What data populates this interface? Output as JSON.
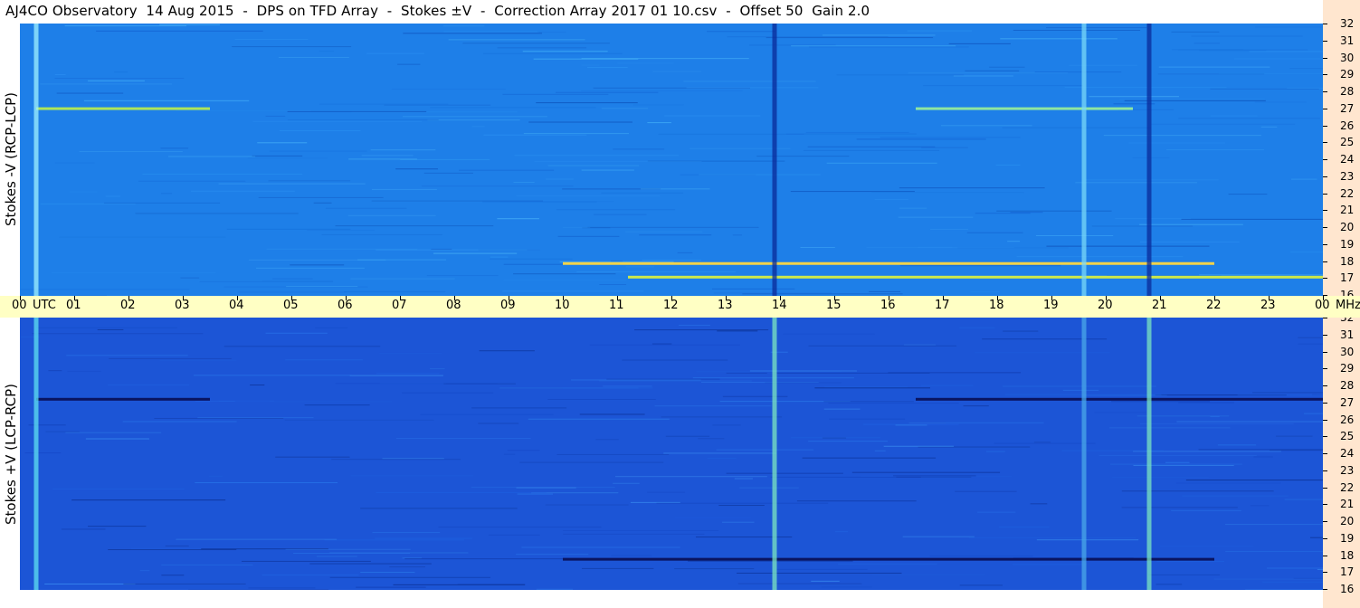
{
  "title": "AJ4CO Observatory  14 Aug 2015  -  DPS on TFD Array  -  Stokes ±V  -  Correction Array 2017 01 10.csv  -  Offset 50  Gain 2.0",
  "top_panel": {
    "ylabel": "Stokes -V (RCP-LCP)"
  },
  "bottom_panel": {
    "ylabel": "Stokes +V (LCP-RCP)"
  },
  "time_axis": {
    "labels": [
      "00",
      "UTC",
      "01",
      "02",
      "03",
      "04",
      "05",
      "06",
      "07",
      "08",
      "09",
      "10",
      "11",
      "12",
      "13",
      "14",
      "15",
      "16",
      "17",
      "18",
      "19",
      "20",
      "21",
      "22",
      "23",
      "00",
      "MHz"
    ]
  },
  "freq_axis": {
    "labels": [
      "32",
      "31",
      "30",
      "29",
      "28",
      "27",
      "26",
      "25",
      "24",
      "23",
      "22",
      "21",
      "20",
      "19",
      "18",
      "17",
      "16"
    ]
  },
  "colors": {
    "top_background": "#1e7fe8",
    "bottom_background": "#1c55d6",
    "time_bar": "#ffffc4",
    "freq_column": "#ffe6cf"
  },
  "chart_data": [
    {
      "type": "heatmap",
      "title": "Stokes -V (RCP-LCP)",
      "x_unit": "UTC hour",
      "y_unit": "MHz",
      "xlim": [
        0,
        24
      ],
      "ylim": [
        16,
        32
      ],
      "features": [
        {
          "kind": "band",
          "freq_mhz": 17.9,
          "t_start": 10.0,
          "t_end": 22.0,
          "color": "#f2d34a"
        },
        {
          "kind": "band",
          "freq_mhz": 17.1,
          "t_start": 11.2,
          "t_end": 24.0,
          "color": "#cce84a"
        },
        {
          "kind": "band",
          "freq_mhz": 27.0,
          "t_start": 0.3,
          "t_end": 3.5,
          "color": "#aee65a"
        },
        {
          "kind": "band",
          "freq_mhz": 27.0,
          "t_start": 16.5,
          "t_end": 20.5,
          "color": "#8fe6a0"
        },
        {
          "kind": "column",
          "t_hour": 0.3,
          "color": "#9ff0ff"
        },
        {
          "kind": "column",
          "t_hour": 13.9,
          "color": "#0a2a9a"
        },
        {
          "kind": "column",
          "t_hour": 19.6,
          "color": "#7ad8f8"
        },
        {
          "kind": "column",
          "t_hour": 20.8,
          "color": "#0a2a9a"
        }
      ]
    },
    {
      "type": "heatmap",
      "title": "Stokes +V (LCP-RCP)",
      "x_unit": "UTC hour",
      "y_unit": "MHz",
      "xlim": [
        0,
        24
      ],
      "ylim": [
        16,
        32
      ],
      "features": [
        {
          "kind": "band",
          "freq_mhz": 17.8,
          "t_start": 10.0,
          "t_end": 22.0,
          "color": "#0a1460"
        },
        {
          "kind": "band",
          "freq_mhz": 27.2,
          "t_start": 0.3,
          "t_end": 3.5,
          "color": "#0a1460"
        },
        {
          "kind": "band",
          "freq_mhz": 27.2,
          "t_start": 16.5,
          "t_end": 24.0,
          "color": "#0a1460"
        },
        {
          "kind": "column",
          "t_hour": 0.3,
          "color": "#5ee0f0"
        },
        {
          "kind": "column",
          "t_hour": 13.9,
          "color": "#7be6c0"
        },
        {
          "kind": "column",
          "t_hour": 19.6,
          "color": "#4aa8e8"
        },
        {
          "kind": "column",
          "t_hour": 20.8,
          "color": "#7be6c0"
        }
      ]
    }
  ]
}
